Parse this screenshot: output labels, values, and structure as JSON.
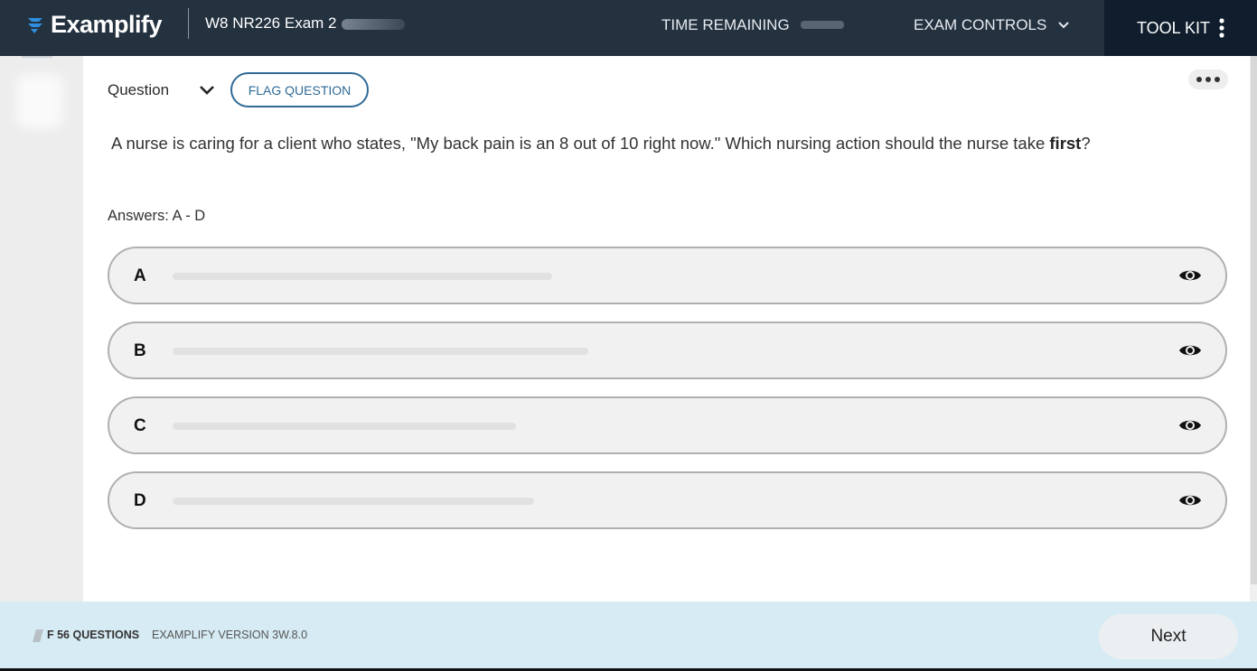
{
  "header": {
    "brand": "Examplify",
    "exam_title": "W8 NR226 Exam 2",
    "time_remaining_label": "TIME REMAINING",
    "exam_controls_label": "EXAM CONTROLS",
    "toolkit_label": "TOOL KIT",
    "colors": {
      "bar": "#24313f",
      "toolkit_bg": "#0f1d2d",
      "brand_accent": "#2f8ee0"
    }
  },
  "question": {
    "label": "Question",
    "flag_label": "FLAG QUESTION",
    "stem_prefix": "A nurse is caring for a client who states, \"My back pain is an 8 out of 10 right now.\"  Which nursing action should the nurse take ",
    "stem_emphasis": "first",
    "stem_suffix": "?",
    "answers_label": "Answers: A - D",
    "answers": [
      {
        "letter": "A",
        "icon": "eye-icon"
      },
      {
        "letter": "B",
        "icon": "eye-icon"
      },
      {
        "letter": "C",
        "icon": "eye-icon"
      },
      {
        "letter": "D",
        "icon": "eye-icon"
      }
    ]
  },
  "footer": {
    "progress": "F 56 QUESTIONS",
    "version": "EXAMPLIFY VERSION 3W.8.0",
    "next_label": "Next"
  }
}
